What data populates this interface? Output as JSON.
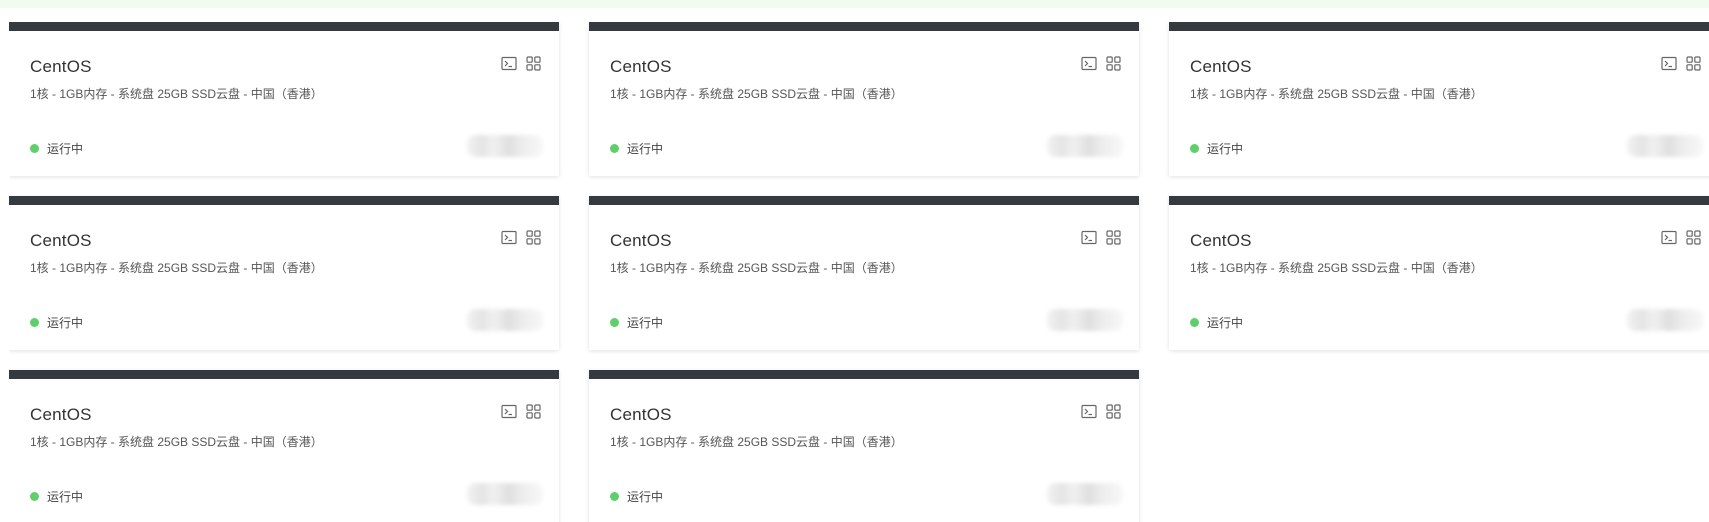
{
  "servers": [
    {
      "name": "CentOS",
      "spec": "1核 - 1GB内存 - 系统盘 25GB SSD云盘 - 中国（香港）",
      "status": "运行中"
    },
    {
      "name": "CentOS",
      "spec": "1核 - 1GB内存 - 系统盘 25GB SSD云盘 - 中国（香港）",
      "status": "运行中"
    },
    {
      "name": "CentOS",
      "spec": "1核 - 1GB内存 - 系统盘 25GB SSD云盘 - 中国（香港）",
      "status": "运行中"
    },
    {
      "name": "CentOS",
      "spec": "1核 - 1GB内存 - 系统盘 25GB SSD云盘 - 中国（香港）",
      "status": "运行中"
    },
    {
      "name": "CentOS",
      "spec": "1核 - 1GB内存 - 系统盘 25GB SSD云盘 - 中国（香港）",
      "status": "运行中"
    },
    {
      "name": "CentOS",
      "spec": "1核 - 1GB内存 - 系统盘 25GB SSD云盘 - 中国（香港）",
      "status": "运行中"
    },
    {
      "name": "CentOS",
      "spec": "1核 - 1GB内存 - 系统盘 25GB SSD云盘 - 中国（香港）",
      "status": "运行中"
    },
    {
      "name": "CentOS",
      "spec": "1核 - 1GB内存 - 系统盘 25GB SSD云盘 - 中国（香港）",
      "status": "运行中"
    }
  ],
  "icons": {
    "terminal": "terminal-icon",
    "details": "grid-icon"
  },
  "colors": {
    "card_header": "#353a40",
    "status_running": "#5fcf6c",
    "top_banner": "#f1fbef"
  }
}
